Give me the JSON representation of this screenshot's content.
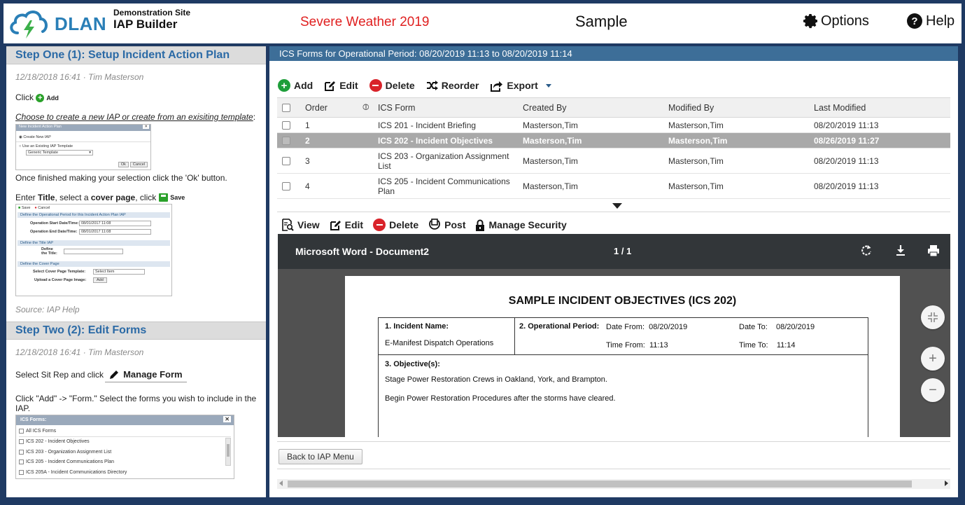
{
  "header": {
    "logo_text": "DLAN",
    "site_name": "Demonstration Site",
    "app_name": "IAP Builder",
    "incident_name": "Severe Weather 2019",
    "plan_name": "Sample",
    "options_label": "Options",
    "help_label": "Help"
  },
  "left": {
    "step1": {
      "title": "Step One (1): Setup Incident Action Plan",
      "meta": "12/18/2018 16:41 · Tim Masterson",
      "click_label": "Click",
      "add_label": "Add",
      "choose_text": "Choose to create a new IAP or create from an exisiting template",
      "choose_suffix": ":",
      "thumb1": {
        "title": "New Incident Action Plan",
        "option1": "Create New IAP",
        "option2": "Use an Existing IAP Template",
        "select": "Generic Template",
        "ok": "Ok",
        "cancel": "Cancel"
      },
      "finished_text": "Once finished making your selection click the 'Ok' button.",
      "enter_prefix": "Enter ",
      "enter_title": "Title",
      "enter_mid": ", select a ",
      "enter_cover": "cover page",
      "enter_suffix": ", click",
      "save_label": "Save",
      "thumb2": {
        "save": "Save",
        "cancel": "Cancel",
        "section1": "Define the Operational Period for this Incident Action Plan IAP",
        "start_label": "Operation Start Date/Time:",
        "start_value": "08/01/2017 11:08",
        "end_label": "Operation End Date/Time:",
        "end_value": "08/01/2017 11:08",
        "section2": "Define the Title IAP",
        "title_label": "Define the Title:",
        "section3": "Define the Cover Page",
        "cover_label": "Select Cover Page Template:",
        "cover_select": "Select Item",
        "upload_label": "Upload a Cover Page Image:",
        "upload_btn": "Add"
      },
      "source": "Source: IAP Help"
    },
    "step2": {
      "title": "Step Two (2): Edit Forms",
      "meta": "12/18/2018 16:41 · Tim Masterson",
      "select_text": "Select Sit Rep and click",
      "manage_form": "Manage Form",
      "click_add_text": "Click \"Add\" -> \"Form.\" Select the forms you wish to include in the IAP.",
      "thumb3": {
        "title": "ICS Forms:",
        "items": [
          "All ICS Forms",
          "ICS 202 - Incident Objectives",
          "ICS 203 - Organization Assignment List",
          "ICS 205 - Incident Communications Plan",
          "ICS 205A - Incident Communications Directory"
        ]
      }
    }
  },
  "right": {
    "title": "ICS Forms for Operational Period: 08/20/2019 11:13 to 08/20/2019 11:14",
    "toolbar": {
      "add": "Add",
      "edit": "Edit",
      "delete": "Delete",
      "reorder": "Reorder",
      "export": "Export"
    },
    "columns": {
      "order": "Order",
      "ics_form": "ICS Form",
      "created_by": "Created By",
      "modified_by": "Modified By",
      "last_modified": "Last Modified"
    },
    "rows": [
      {
        "order": "1",
        "form": "ICS 201 - Incident Briefing",
        "created": "Masterson,Tim",
        "modified": "Masterson,Tim",
        "last": "08/20/2019 11:13"
      },
      {
        "order": "2",
        "form": "ICS 202 - Incident Objectives",
        "created": "Masterson,Tim",
        "modified": "Masterson,Tim",
        "last": "08/26/2019 11:27"
      },
      {
        "order": "3",
        "form": "ICS 203 - Organization Assignment List",
        "created": "Masterson,Tim",
        "modified": "Masterson,Tim",
        "last": "08/20/2019 11:13"
      },
      {
        "order": "4",
        "form": "ICS 205 - Incident Communications Plan",
        "created": "Masterson,Tim",
        "modified": "Masterson,Tim",
        "last": "08/20/2019 11:13"
      }
    ],
    "doc_toolbar": {
      "view": "View",
      "edit": "Edit",
      "delete": "Delete",
      "post": "Post",
      "manage_security": "Manage Security"
    },
    "viewer": {
      "title": "Microsoft Word - Document2",
      "pages": "1 / 1",
      "heading": "SAMPLE INCIDENT OBJECTIVES (ICS 202)",
      "incident_name_label": "1. Incident Name:",
      "incident_name_value": "E-Manifest Dispatch Operations",
      "op_period_label": "2. Operational Period:",
      "date_from_label": "Date From:",
      "date_from_value": "08/20/2019",
      "date_to_label": "Date To:",
      "date_to_value": "08/20/2019",
      "time_from_label": "Time From:",
      "time_from_value": "11:13",
      "time_to_label": "Time To:",
      "time_to_value": "11:14",
      "objectives_label": "3. Objective(s):",
      "objective_1": "Stage Power Restoration Crews in Oakland, York, and Brampton.",
      "objective_2": "Begin Power Restoration Procedures after the storms have cleared."
    },
    "back_button": "Back to IAP Menu"
  },
  "colors": {
    "page_bg": "#1f3a63",
    "panel_title_bg": "#3d6e98",
    "step_title": "#2b6aa6",
    "incident_red": "#e02020",
    "selected_row": "#a9a9a9",
    "add_green": "#1e9e3a",
    "delete_red": "#d9232a"
  },
  "icons": [
    "cloud-bolt-logo",
    "gear-icon",
    "question-circle-icon",
    "plus-circle-icon",
    "edit-icon",
    "minus-circle-icon",
    "shuffle-icon",
    "export-icon",
    "caret-down-icon",
    "paperclip-icon",
    "view-icon",
    "post-icon",
    "lock-icon",
    "rotate-icon",
    "download-icon",
    "print-icon",
    "fit-page-icon",
    "zoom-in-icon",
    "zoom-out-icon",
    "pencil-icon"
  ]
}
